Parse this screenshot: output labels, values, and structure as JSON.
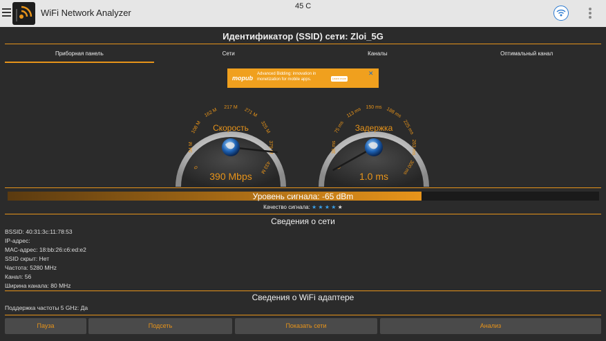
{
  "app": {
    "title": "WiFi Network Analyzer",
    "status_temp": "45 C"
  },
  "ssid_title": "Идентификатор (SSID) сети: Zloi_5G",
  "tabs": [
    {
      "label": "Приборная панель",
      "active": true
    },
    {
      "label": "Сети",
      "active": false
    },
    {
      "label": "Каналы",
      "active": false
    },
    {
      "label": "Оптимальный канал",
      "active": false
    }
  ],
  "ad": {
    "brand": "mopub",
    "text": "Advanced Bidding: innovation in monetization for mobile apps.",
    "button": "Learn more",
    "close": "✕"
  },
  "gauges": {
    "speed": {
      "label": "Скорость",
      "value_text": "390 Mbps",
      "value": 390,
      "min": 0,
      "max": 433,
      "ticks": [
        "0",
        "54 M",
        "108 M",
        "162 M",
        "217 M",
        "271 M",
        "325 M",
        "379 M",
        "433 M"
      ]
    },
    "latency": {
      "label": "Задержка",
      "value_text": "1.0 ms",
      "value": 1.0,
      "min": 0,
      "max": 300,
      "ticks": [
        "0",
        "38 ms",
        "75 ms",
        "113 ms",
        "150 ms",
        "188 ms",
        "225 ms",
        "263 ms",
        "300 ms"
      ]
    }
  },
  "signal": {
    "label": "Уровень сигнала: -65 dBm",
    "level": 0.7
  },
  "quality": {
    "label": "Качество сигнала:",
    "stars_on": 4,
    "stars_total": 5
  },
  "network_info": {
    "title": "Сведения о сети",
    "lines": [
      "BSSID: 40:31:3c:11:78:53",
      "IP-адрес:",
      "MAC-адрес: 18:bb:26:c6:ed:e2",
      "SSID скрыт: Нет",
      "Частота: 5280 MHz",
      "Канал: 56",
      "Ширина канала: 80 MHz"
    ]
  },
  "adapter_info": {
    "title": "Сведения о WiFi адаптере",
    "lines": [
      "Поддержка частоты 5 GHz: Да"
    ]
  },
  "buttons": {
    "pause": "Пауза",
    "connect": "Подсеть",
    "show_networks": "Показать сети",
    "analyze": "Анализ"
  },
  "colors": {
    "accent": "#e8941a",
    "background": "#2b2b2b",
    "appbar": "#e6e6e6",
    "star": "#3aa0e8"
  }
}
